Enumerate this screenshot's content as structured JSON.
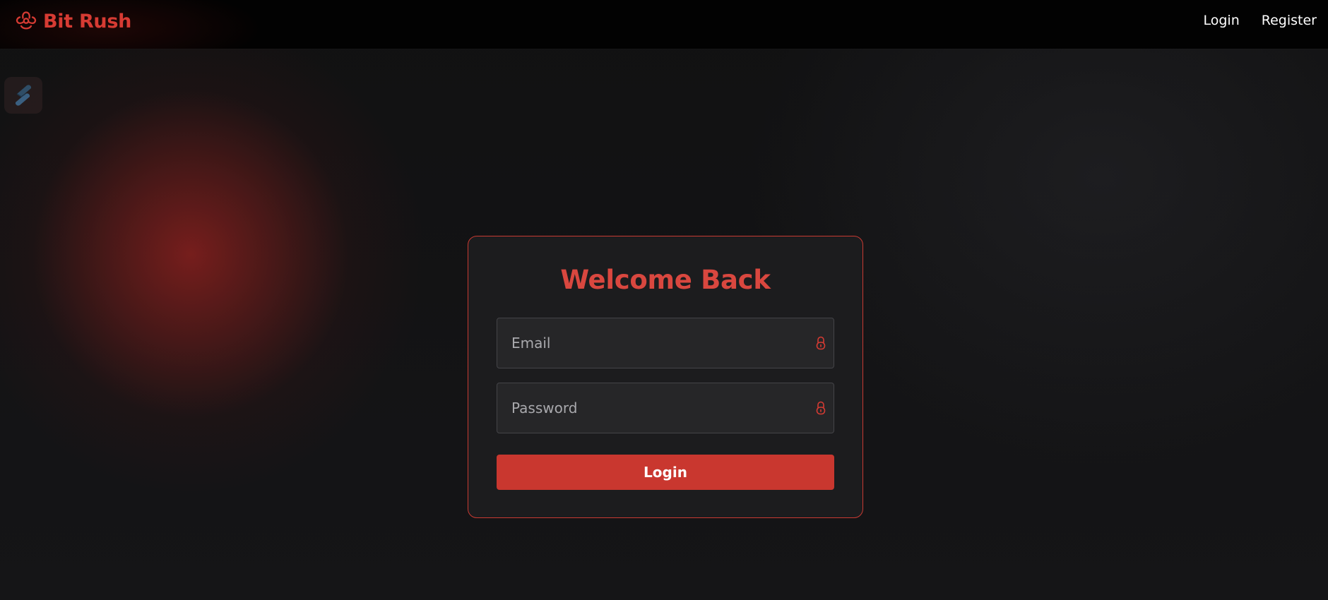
{
  "brand": {
    "name": "Bit Rush",
    "icon": "biohazard-icon"
  },
  "nav": {
    "login_label": "Login",
    "register_label": "Register"
  },
  "side_tool": {
    "icon": "tool-badge-icon"
  },
  "login_form": {
    "title": "Welcome Back",
    "email_placeholder": "Email",
    "email_value": "",
    "email_icon": "lock-icon",
    "password_placeholder": "Password",
    "password_value": "",
    "password_icon": "lock-icon",
    "submit_label": "Login"
  },
  "colors": {
    "accent": "#d63b33",
    "button": "#c9372f",
    "card_border": "#c83a32",
    "background": "#141416",
    "topbar": "#020202"
  }
}
